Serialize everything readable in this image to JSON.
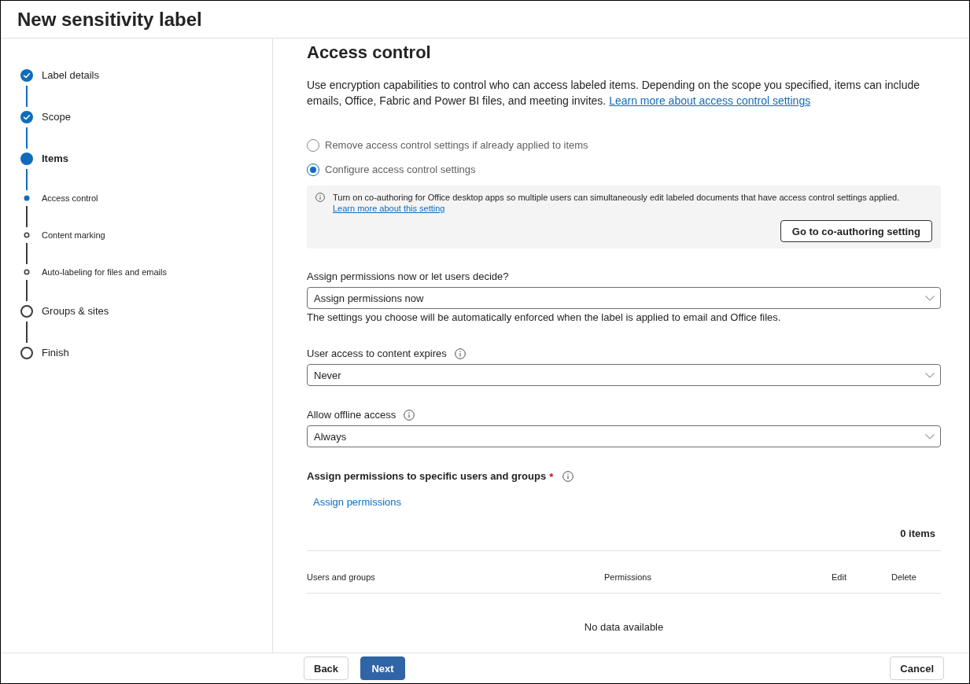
{
  "header": {
    "title": "New sensitivity label"
  },
  "steps": [
    {
      "label": "Label details",
      "kind": "step",
      "completed": true,
      "current": false
    },
    {
      "label": "Scope",
      "kind": "step",
      "completed": true,
      "current": false
    },
    {
      "label": "Items",
      "kind": "step",
      "completed": false,
      "current": true
    },
    {
      "label": "Access control",
      "kind": "substep",
      "completed": false,
      "current": true
    },
    {
      "label": "Content marking",
      "kind": "substep",
      "completed": false,
      "current": false
    },
    {
      "label": "Auto-labeling for files and emails",
      "kind": "substep",
      "completed": false,
      "current": false
    },
    {
      "label": "Groups & sites",
      "kind": "step",
      "completed": false,
      "current": false
    },
    {
      "label": "Finish",
      "kind": "step",
      "completed": false,
      "current": false
    }
  ],
  "section": {
    "title": "Access control",
    "description": "Use encryption capabilities to control who can access labeled items. Depending on the scope you specified, items can include emails, Office, Fabric and Power BI files, and meeting invites.",
    "description_link": "Learn more about access control settings"
  },
  "options": [
    {
      "label": "Remove access control settings if already applied to items",
      "selected": false
    },
    {
      "label": "Configure access control settings",
      "selected": true
    }
  ],
  "notice": {
    "text": "Turn on co-authoring for Office desktop apps so multiple users can simultaneously edit labeled documents that have access control settings applied.",
    "link": "Learn more about this setting",
    "button": "Go to co-authoring setting"
  },
  "fields": [
    {
      "label": "Assign permissions now or let users decide?",
      "info": false,
      "value": "Assign permissions now",
      "help": "The settings you choose will be automatically enforced when the label is applied to email and Office files."
    },
    {
      "label": "User access to content expires",
      "info": true,
      "value": "Never"
    },
    {
      "label": "Allow offline access",
      "info": true,
      "value": "Always"
    }
  ],
  "permissions": {
    "title": "Assign permissions to specific users and groups",
    "required_mark": "*",
    "info": true,
    "action": "Assign permissions",
    "count": "0 items",
    "columns": [
      "Users and groups",
      "Permissions",
      "Edit",
      "Delete"
    ],
    "empty": "No data available"
  },
  "footer": {
    "nav_buttons": [
      {
        "label": "Back",
        "kind": "secondary"
      },
      {
        "label": "Next",
        "kind": "primary"
      }
    ],
    "cancel_button": "Cancel"
  }
}
